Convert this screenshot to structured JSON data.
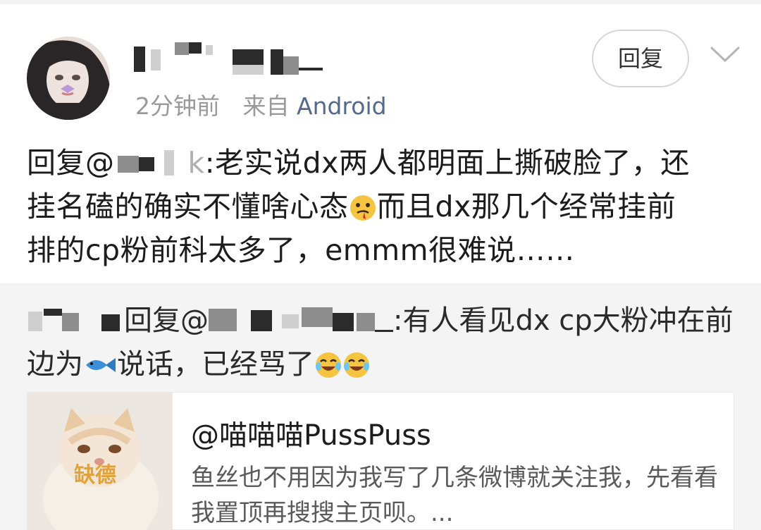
{
  "post": {
    "time": "2分钟前",
    "from_label": "来自",
    "source": "Android"
  },
  "actions": {
    "reply_label": "回复"
  },
  "icons": {
    "expand": "chevron-down-icon",
    "emoji_a": "bleeding-face-emoji",
    "emoji_fish": "fish-emoji",
    "emoji_laugh": "laughing-crying-emoji"
  },
  "comment": {
    "prefix": "回复@",
    "name_tail": "k",
    "line1_rest": ":老实说dx两人都明面上撕破脸了，还",
    "line2": "挂名磕的确实不懂啥心态",
    "line2_rest": "而且dx那几个经常挂前",
    "line3": "排的cp粉前科太多了，emmm很难说……"
  },
  "nested": {
    "reply_word": "回复",
    "at": "@",
    "text1": ":有人看见dx cp大粉冲在前",
    "text2a": "边为",
    "text2b": "说话，已经骂了"
  },
  "card": {
    "thumb_label": "缺德",
    "title": "@喵喵喵PussPuss",
    "description": "鱼丝也不用因为我写了几条微博就关注我，先看看我置顶再搜搜主页呗。..."
  },
  "colors": {
    "link": "#536a8c",
    "meta": "#9a9a9a",
    "nested_bg": "#f4f4f4"
  }
}
